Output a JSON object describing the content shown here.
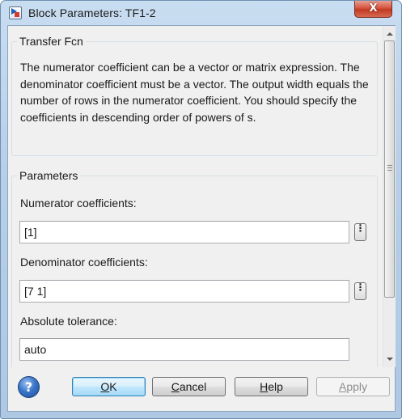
{
  "window": {
    "title": "Block Parameters: TF1-2",
    "close_glyph": "X",
    "app_icon": "simulink-block-icon"
  },
  "description_group": {
    "legend": "Transfer Fcn",
    "text": "The numerator coefficient can be a vector or matrix expression. The denominator coefficient must be a vector. The output width equals the number of rows in the numerator coefficient. You should specify the coefficients in descending order of powers of s."
  },
  "parameters_group": {
    "legend": "Parameters",
    "numerator": {
      "label": "Numerator coefficients:",
      "value": "[1]"
    },
    "denominator": {
      "label": "Denominator coefficients:",
      "value": "[7 1]"
    },
    "tolerance": {
      "label": "Absolute tolerance:",
      "value": "auto"
    },
    "more_glyph": "⋮"
  },
  "buttons": {
    "help_icon_glyph": "?",
    "ok": {
      "mnemonic": "O",
      "rest": "K"
    },
    "cancel": {
      "mnemonic": "C",
      "rest": "ancel"
    },
    "help": {
      "mnemonic": "H",
      "rest": "elp"
    },
    "apply": {
      "mnemonic": "A",
      "rest": "pply"
    }
  },
  "colors": {
    "titlebar": "#c9ddf1",
    "close_button": "#c23a22",
    "default_button": "#bee6fd",
    "dialog_background": "#f0f0f0"
  }
}
